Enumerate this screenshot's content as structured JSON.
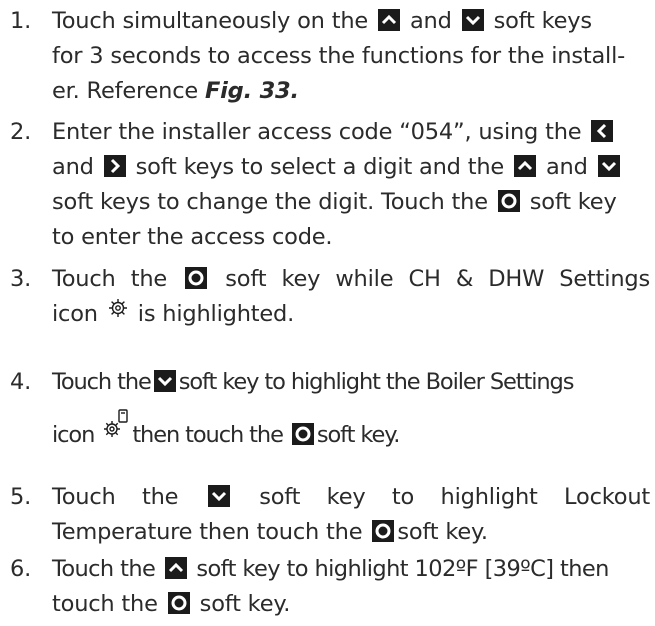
{
  "icons": {
    "up": "up-soft-key-icon",
    "down": "down-soft-key-icon",
    "left": "left-soft-key-icon",
    "right": "right-soft-key-icon",
    "ok": "enter-soft-key-icon",
    "ch_dhw": "ch-dhw-settings-gear-icon",
    "boiler": "boiler-settings-gear-icon"
  },
  "steps": [
    {
      "number": "1.",
      "t1": "Touch simultaneously on the",
      "t2": "and",
      "t3": "soft keys",
      "t4": "for 3 seconds to access the functions for the install-",
      "t5": "er. Reference",
      "ref": "Fig. 33."
    },
    {
      "number": "2.",
      "t1": "Enter the installer access code “054”, using the",
      "t2": "and",
      "t3": "soft keys to select a digit and the",
      "t4": "and",
      "t5": "soft keys to change the digit. Touch the",
      "t6": "soft key",
      "t7": "to enter the access code."
    },
    {
      "number": "3.",
      "t1": "Touch the",
      "t2": "soft key while CH & DHW Settings",
      "t3": "icon",
      "t4": "is highlighted."
    },
    {
      "number": "4.",
      "t1": "Touch the",
      "t2": "soft key to highlight the Boiler Settings",
      "t3": "icon",
      "t4": "then touch the",
      "t5": "soft key."
    },
    {
      "number": "5.",
      "t1": "Touch the",
      "t2": "soft key to highlight Lockout",
      "t3": "Temperature then touch the",
      "t4": "soft key."
    },
    {
      "number": "6.",
      "t1": "Touch the",
      "t2": "soft key to highlight 102ºF [39ºC] then",
      "t3": "touch the",
      "t4": "soft key."
    }
  ]
}
